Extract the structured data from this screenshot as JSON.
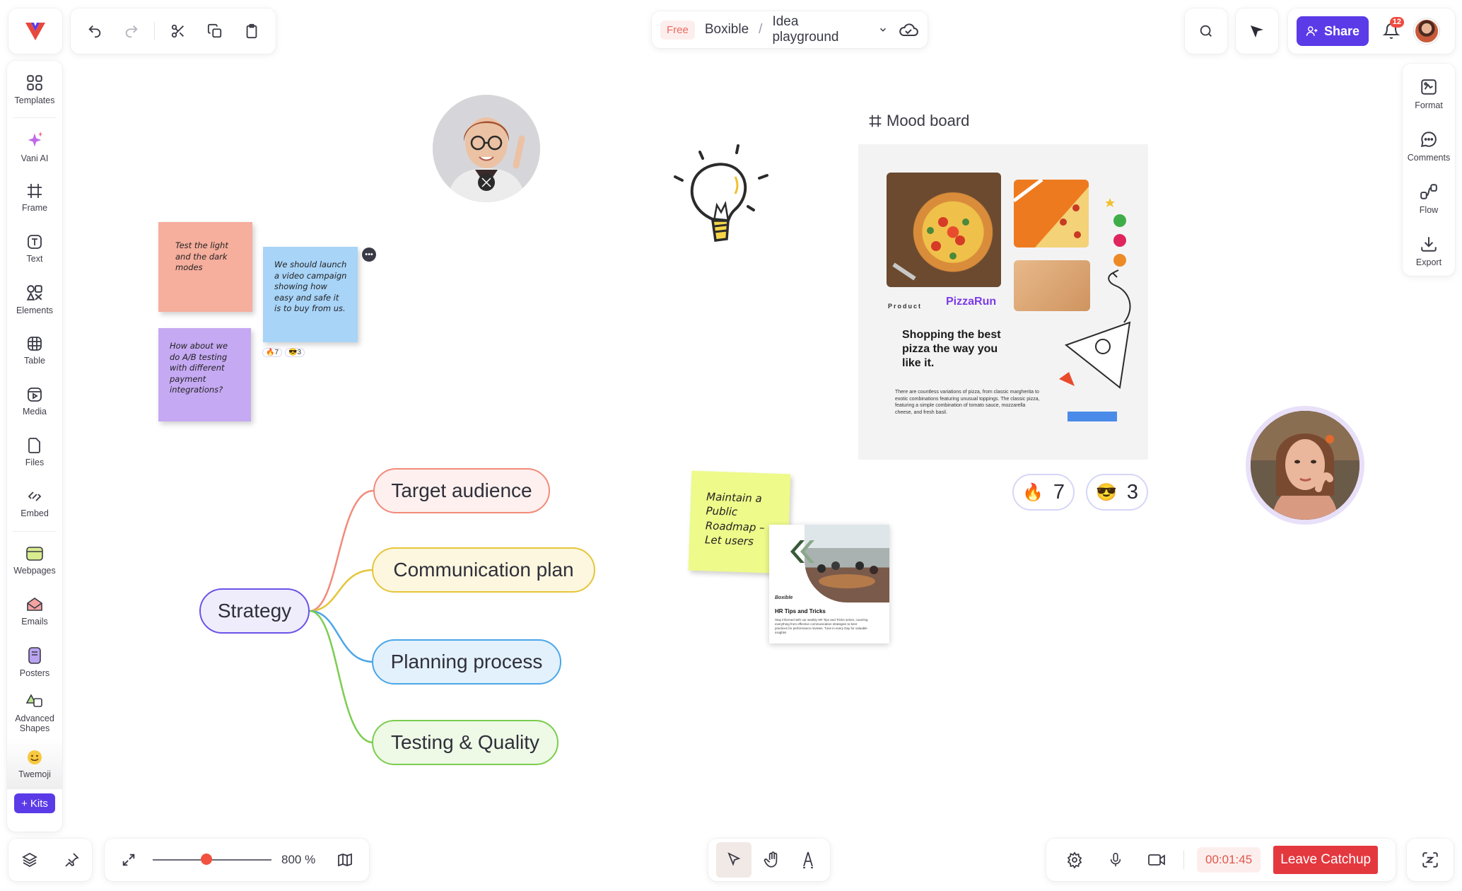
{
  "app": {
    "plan_badge": "Free",
    "workspace": "Boxible",
    "board_title": "Idea playground"
  },
  "colors": {
    "accent": "#5b3be8",
    "danger": "#e4383f",
    "badge_red": "#ee4b40"
  },
  "toolbar": {
    "icons": [
      "undo-icon",
      "redo-icon",
      "cut-icon",
      "copy-icon",
      "paste-icon"
    ],
    "share_label": "Share",
    "notification_count": "12"
  },
  "sidebar_left": {
    "items": [
      {
        "label": "Templates"
      },
      {
        "label": "Vani AI"
      },
      {
        "label": "Frame"
      },
      {
        "label": "Text"
      },
      {
        "label": "Elements"
      },
      {
        "label": "Table"
      },
      {
        "label": "Media"
      },
      {
        "label": "Files"
      },
      {
        "label": "Embed"
      },
      {
        "label": "Webpages"
      },
      {
        "label": "Emails"
      },
      {
        "label": "Posters"
      },
      {
        "label": "Advanced Shapes"
      },
      {
        "label": "Twemoji"
      }
    ],
    "kits_label": "Kits"
  },
  "sidebar_right": {
    "items": [
      {
        "label": "Format"
      },
      {
        "label": "Comments"
      },
      {
        "label": "Flow"
      },
      {
        "label": "Export"
      }
    ]
  },
  "canvas": {
    "stickies": {
      "s1": "Test the light and the dark modes",
      "s2": "We should launch a video campaign showing how easy and safe it is to buy from us.",
      "s3": "How about we do A/B testing with different payment integrations?",
      "s4": "Maintain a Public Roadmap – Let users"
    },
    "sticky_reactions": {
      "fire": "7",
      "cool": "3"
    },
    "mood_board": {
      "title": "Mood board",
      "product_label": "Product",
      "brand": "PizzaRun",
      "headline": "Shopping the best pizza the way you like it.",
      "body": "There are countless variations of pizza, from classic margherita to exotic combinations featuring unusual toppings. The classic pizza, featuring a simple combination of tomato sauce, mozzarella cheese, and fresh basil."
    },
    "board_reactions": {
      "fire": "7",
      "cool": "3"
    },
    "hr_card": {
      "logo": "Boxible",
      "title": "HR Tips and Tricks",
      "body": "Stay informed with our weekly HR Tips and Tricks series, covering everything from effective communication strategies to best practices for performance reviews. Tune in every Day for valuable insights!"
    },
    "mind_map": {
      "root": "Strategy",
      "children": [
        {
          "label": "Target audience",
          "color": "#f28a7a"
        },
        {
          "label": "Communication plan",
          "color": "#e5c53a"
        },
        {
          "label": "Planning process",
          "color": "#4aa6e8"
        },
        {
          "label": "Testing & Quality",
          "color": "#7ccd4f"
        }
      ]
    }
  },
  "bottom": {
    "zoom_value": "800 %",
    "zoom_level_fraction": 0.45,
    "timer": "00:01:45",
    "leave_label": "Leave Catchup"
  }
}
